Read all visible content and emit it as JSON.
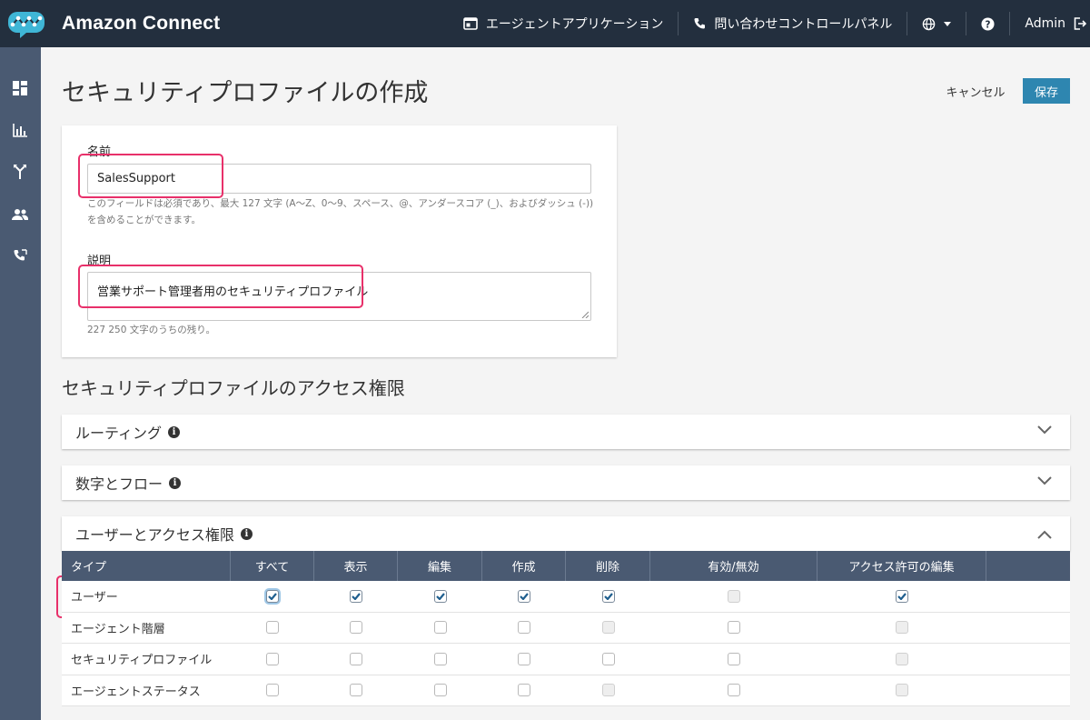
{
  "header": {
    "brand": "Amazon Connect",
    "agent_app": "エージェントアプリケーション",
    "ccp": "問い合わせコントロールパネル",
    "user": "Admin"
  },
  "page": {
    "title": "セキュリティプロファイルの作成",
    "cancel": "キャンセル",
    "save": "保存"
  },
  "form": {
    "name_label": "名前",
    "name_value": "SalesSupport",
    "name_hint": "このフィールドは必須であり、最大 127 文字 (A～Z、0～9、スペース、@、アンダースコア (_)、およびダッシュ (-))を含めることができます。",
    "desc_label": "説明",
    "desc_value": "営業サポート管理者用のセキュリティプロファイル",
    "desc_hint": "227 250 文字のうちの残り。"
  },
  "permissions": {
    "title": "セキュリティプロファイルのアクセス権限",
    "sections": [
      {
        "label": "ルーティング",
        "expanded": false
      },
      {
        "label": "数字とフロー",
        "expanded": false
      },
      {
        "label": "ユーザーとアクセス権限",
        "expanded": true
      }
    ],
    "columns": [
      "タイプ",
      "すべて",
      "表示",
      "編集",
      "作成",
      "削除",
      "有効/無効",
      "アクセス許可の編集"
    ],
    "rows": [
      {
        "type": "ユーザー",
        "all": true,
        "view": true,
        "edit": true,
        "create": true,
        "delete": true,
        "enable": "disabled",
        "access": true
      },
      {
        "type": "エージェント階層",
        "all": false,
        "view": false,
        "edit": false,
        "create": false,
        "delete": "disabled",
        "enable": false,
        "access": "disabled"
      },
      {
        "type": "セキュリティプロファイル",
        "all": false,
        "view": false,
        "edit": false,
        "create": false,
        "delete": false,
        "enable": false,
        "access": "disabled"
      },
      {
        "type": "エージェントステータス",
        "all": false,
        "view": false,
        "edit": false,
        "create": false,
        "delete": "disabled",
        "enable": false,
        "access": "disabled"
      }
    ]
  },
  "colors": {
    "topbar": "#232f3e",
    "sidebar": "#4a5a72",
    "primary": "#2e86b0",
    "highlight": "#e8306a"
  }
}
